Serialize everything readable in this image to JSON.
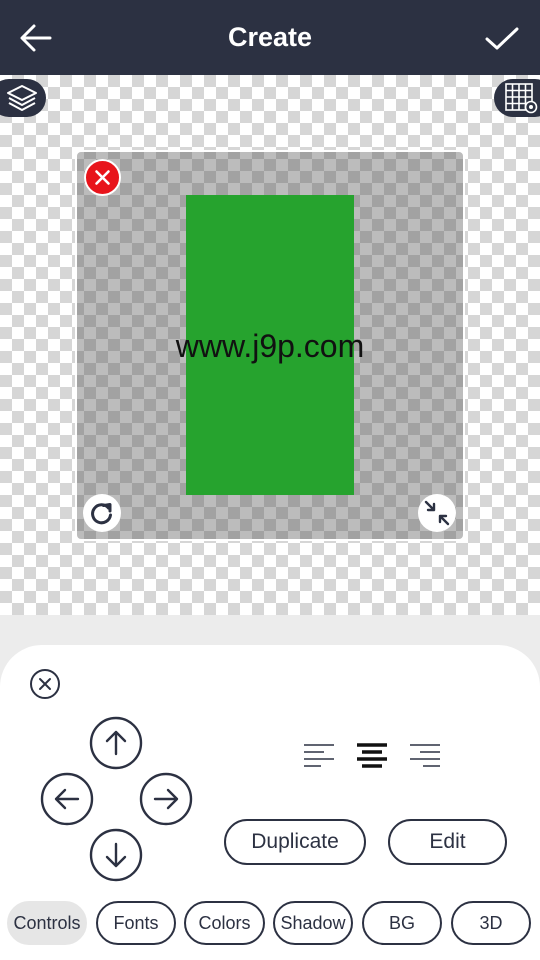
{
  "header": {
    "title": "Create",
    "back_icon": "arrow-left-icon",
    "confirm_icon": "check-icon"
  },
  "canvas": {
    "layers_icon": "layers-icon",
    "grid_icon": "grid-settings-icon",
    "sticker": {
      "text": "www.j9p.com",
      "background_color": "#26a32e",
      "text_color": "#111111"
    },
    "handles": {
      "delete_icon": "close-icon",
      "rotate_icon": "rotate-icon",
      "scale_icon": "shrink-icon"
    }
  },
  "controls_panel": {
    "close_icon": "close-circle-icon",
    "move_icons": [
      "arrow-up-icon",
      "arrow-left-icon",
      "arrow-right-icon",
      "arrow-down-icon"
    ],
    "align_icons": [
      "align-left-icon",
      "align-center-icon",
      "align-right-icon"
    ],
    "selected_alignment": "center",
    "duplicate_label": "Duplicate",
    "edit_label": "Edit"
  },
  "tabs": [
    {
      "label": "Controls",
      "active": true
    },
    {
      "label": "Fonts",
      "active": false
    },
    {
      "label": "Colors",
      "active": false
    },
    {
      "label": "Shadow",
      "active": false
    },
    {
      "label": "BG",
      "active": false
    },
    {
      "label": "3D",
      "active": false
    }
  ],
  "colors": {
    "header_bg": "#2c3142",
    "accent": "#2c3142",
    "delete": "#e8141b"
  }
}
